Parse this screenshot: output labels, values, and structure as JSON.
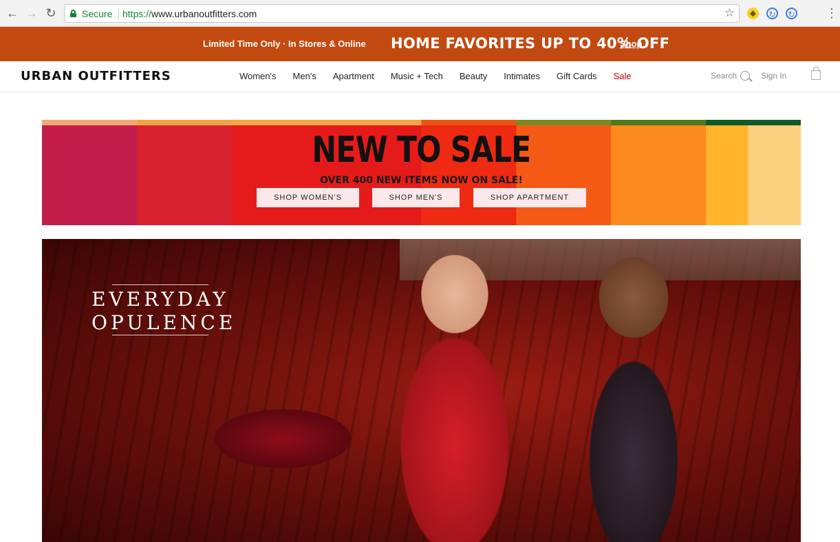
{
  "browser": {
    "secure_label": "Secure",
    "url_scheme": "https://",
    "url_host": "www.urbanoutfitters.com"
  },
  "promo": {
    "left_text": "Limited Time Only · In Stores & Online",
    "headline": "HOME FAVORITES UP TO 40% OFF",
    "link": "Shop"
  },
  "header": {
    "logo": "URBAN OUTFITTERS",
    "nav": [
      "Women's",
      "Men's",
      "Apartment",
      "Music + Tech",
      "Beauty",
      "Intimates",
      "Gift Cards",
      "Sale"
    ],
    "search_label": "Search",
    "signin_label": "Sign In"
  },
  "sale_banner": {
    "title": "NEW TO SALE",
    "subtitle": "OVER 400 NEW ITEMS NOW ON SALE!",
    "buttons": [
      "SHOP WOMEN'S",
      "SHOP MEN'S",
      "SHOP APARTMENT"
    ]
  },
  "hero": {
    "line1": "EVERYDAY",
    "line2": "OPULENCE"
  },
  "colors": {
    "promo_bg": "#c24a11",
    "sale_nav": "#c40000",
    "secure_green": "#188038"
  },
  "icons": [
    "back-arrow-icon",
    "forward-arrow-icon",
    "reload-icon",
    "lock-icon",
    "star-icon",
    "extension-icon",
    "sync-icon",
    "menu-icon",
    "search-icon",
    "bag-icon"
  ]
}
